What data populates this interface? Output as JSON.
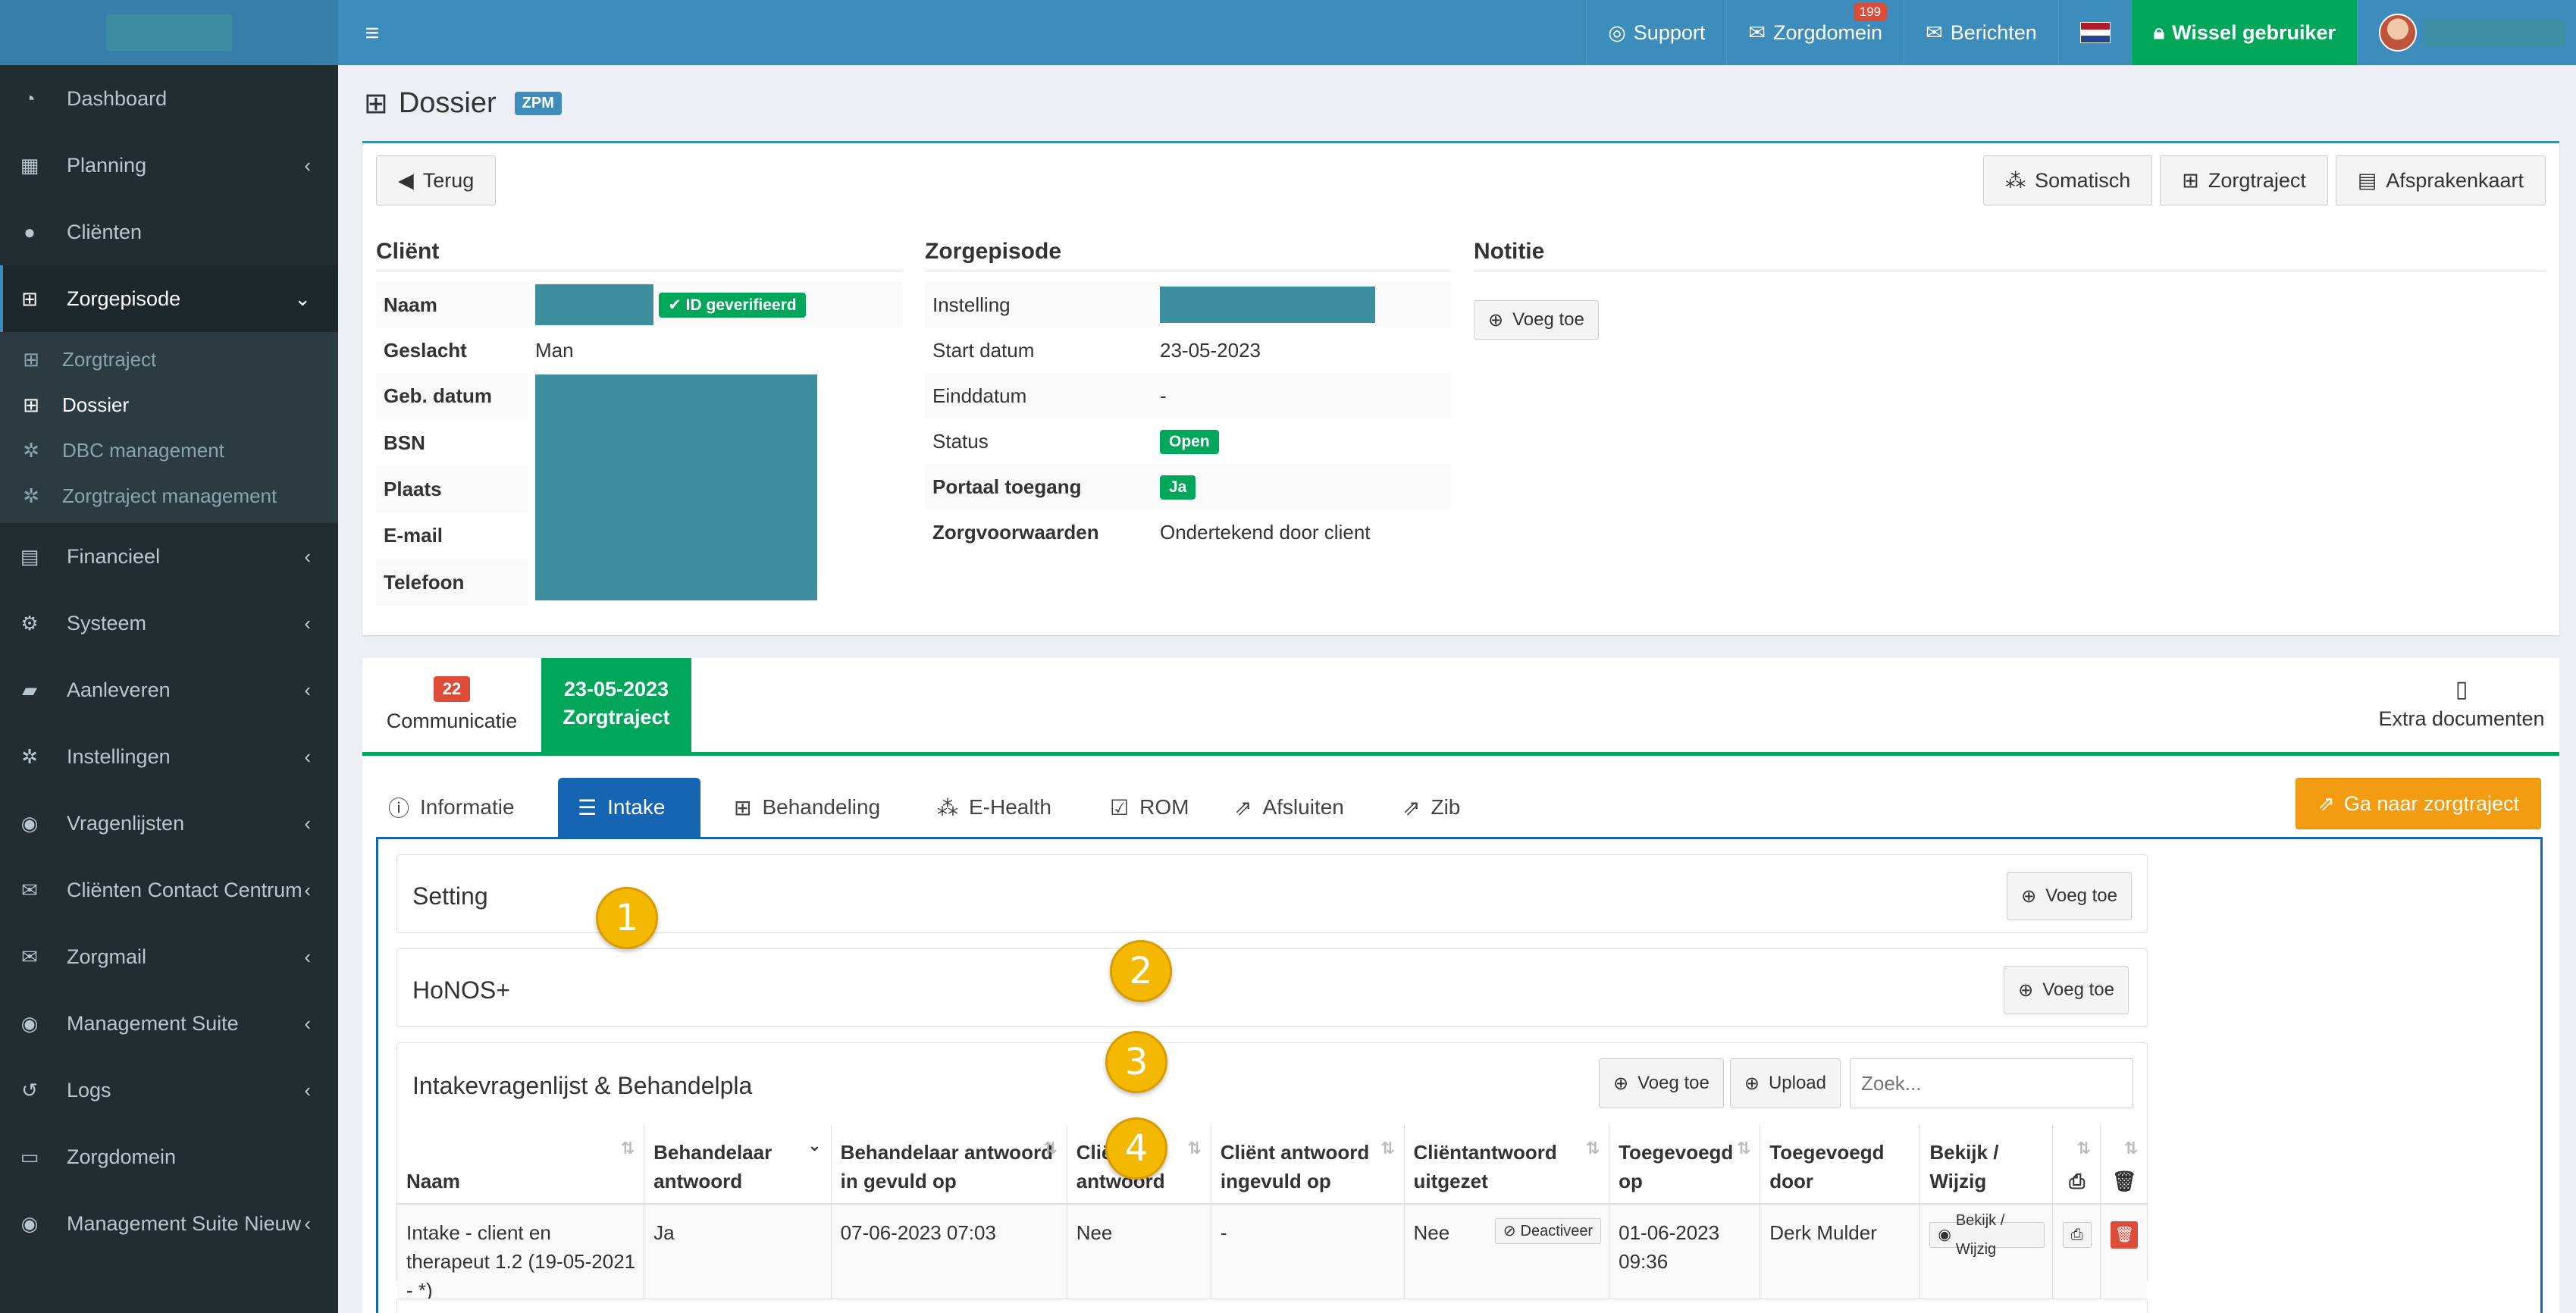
{
  "sidebar": {
    "items": [
      {
        "label": "Dashboard",
        "icon": "dashboard-icon"
      },
      {
        "label": "Planning",
        "icon": "calendar-icon"
      },
      {
        "label": "Cliënten",
        "icon": "user-icon"
      },
      {
        "label": "Zorgepisode",
        "icon": "medkit-icon"
      },
      {
        "label": "Financieel",
        "icon": "book-icon"
      },
      {
        "label": "Systeem",
        "icon": "cogs-icon"
      },
      {
        "label": "Aanleveren",
        "icon": "truck-icon"
      },
      {
        "label": "Instellingen",
        "icon": "gear-icon"
      },
      {
        "label": "Vragenlijsten",
        "icon": "globe-icon"
      },
      {
        "label": "Cliënten Contact Centrum",
        "icon": "envelope-icon"
      },
      {
        "label": "Zorgmail",
        "icon": "envelope-icon"
      },
      {
        "label": "Management Suite",
        "icon": "globe-icon"
      },
      {
        "label": "Logs",
        "icon": "history-icon"
      },
      {
        "label": "Zorgdomein",
        "icon": "inbox-icon"
      },
      {
        "label": "Management Suite Nieuw",
        "icon": "globe-icon"
      }
    ],
    "submenu": [
      {
        "label": "Zorgtraject"
      },
      {
        "label": "Dossier"
      },
      {
        "label": "DBC management"
      },
      {
        "label": "Zorgtraject management"
      }
    ]
  },
  "topbar": {
    "support": "Support",
    "zorgdomein": "Zorgdomein",
    "zorgdomein_badge": "199",
    "berichten": "Berichten",
    "wissel": "Wissel gebruiker"
  },
  "page": {
    "title": "Dossier",
    "tag": "ZPM"
  },
  "toolbar": {
    "back": "Terug",
    "somatisch": "Somatisch",
    "zorgtraject": "Zorgtraject",
    "afsprakenkaart": "Afsprakenkaart"
  },
  "client": {
    "heading": "Cliënt",
    "verified": "ID geverifieerd",
    "rows": [
      {
        "key": "Naam",
        "value": ""
      },
      {
        "key": "Geslacht",
        "value": "Man"
      },
      {
        "key": "Geb. datum",
        "value": ""
      },
      {
        "key": "BSN",
        "value": ""
      },
      {
        "key": "Plaats",
        "value": ""
      },
      {
        "key": "E-mail",
        "value": ""
      },
      {
        "key": "Telefoon",
        "value": ""
      }
    ]
  },
  "episode": {
    "heading": "Zorgepisode",
    "rows": [
      {
        "key": "Instelling",
        "value": ""
      },
      {
        "key": "Start datum",
        "value": "23-05-2023"
      },
      {
        "key": "Einddatum",
        "value": "-"
      },
      {
        "key": "Status",
        "value": "Open"
      },
      {
        "key": "Portaal toegang",
        "value": "Ja"
      },
      {
        "key": "Zorgvoorwaarden",
        "value": "Ondertekend door client"
      }
    ]
  },
  "notitie": {
    "heading": "Notitie",
    "add": "Voeg toe"
  },
  "tabs": {
    "communicatie_count": "22",
    "communicatie": "Communicatie",
    "zorgtraject_date": "23-05-2023",
    "zorgtraject": "Zorgtraject",
    "extra": "Extra documenten"
  },
  "subtabs": [
    "Informatie",
    "Intake",
    "Behandeling",
    "E-Health",
    "ROM",
    "Afsluiten",
    "Zib"
  ],
  "go_button": "Ga naar zorgtraject",
  "panels": {
    "setting": "Setting",
    "honos": "HoNOS+",
    "intake": "Intakevragenlijst & Behandelpla",
    "add": "Voeg toe",
    "upload": "Upload",
    "search_placeholder": "Zoek..."
  },
  "markers": [
    "1",
    "2",
    "3",
    "4"
  ],
  "table": {
    "headers": [
      "Naam",
      "Behandelaar antwoord",
      "Behandelaar antwoord in gevuld op",
      "Cliënt antwoord",
      "Cliënt antwoord ingevuld op",
      "Cliëntantwoord uitgezet",
      "Toegevoegd op",
      "Toegevoegd door",
      "Bekijk / Wijzig"
    ],
    "row": {
      "naam": "Intake - client en therapeut 1.2 (19-05-2021 - *)",
      "behandelaar": "Ja",
      "behandelaar_op": "07-06-2023 07:03",
      "client": "Nee",
      "client_op": "-",
      "uitgezet": "Nee",
      "deactiveer": "Deactiveer",
      "toegevoegd_op": "01-06-2023 09:36",
      "toegevoegd_door": "Derk Mulder",
      "bekijk": "Bekijk / Wijzig"
    }
  },
  "colors": {
    "primary": "#3c8dbc",
    "sidebar": "#222d32",
    "success": "#00a65a",
    "danger": "#dd4b39",
    "warning": "#f39c12",
    "active_tab": "#1565b2",
    "marker": "#f5b800"
  }
}
